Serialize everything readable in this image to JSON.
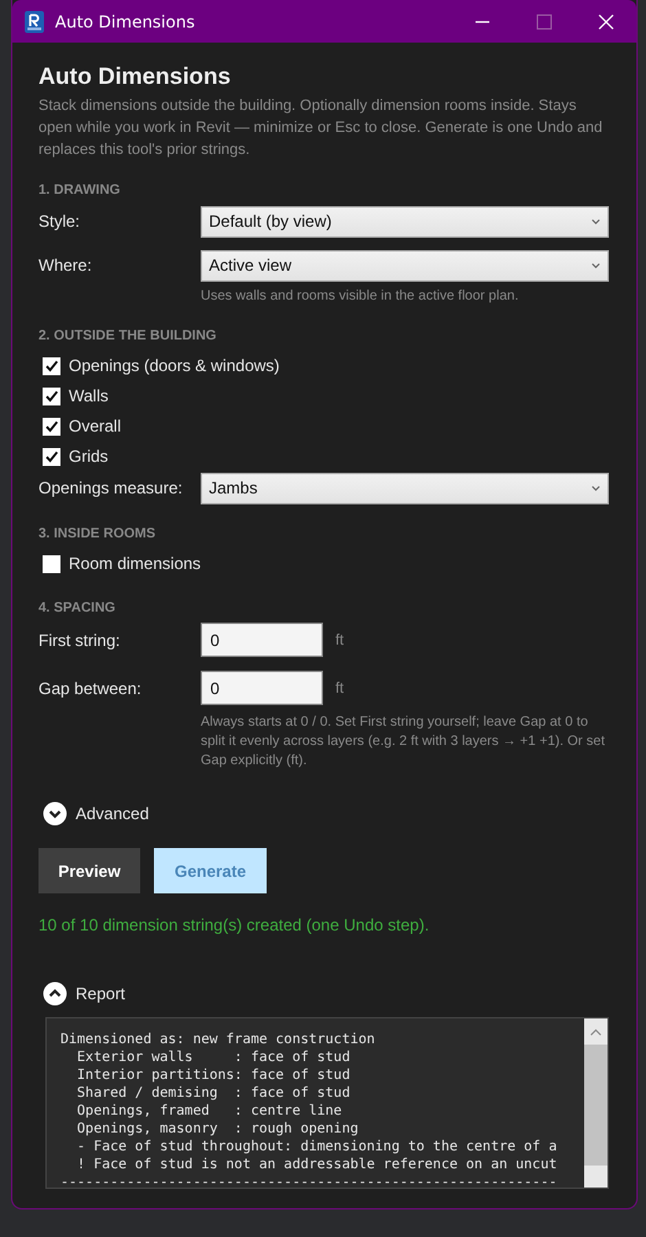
{
  "window": {
    "title": "Auto Dimensions"
  },
  "heading": "Auto Dimensions",
  "description": "Stack dimensions outside the building. Optionally dimension rooms inside. Stays open while you work in Revit — minimize or Esc to close. Generate is one Undo and replaces this tool's prior strings.",
  "sections": [
    {
      "title": "1. DRAWING",
      "items": [
        {
          "kind": "dropdown",
          "label": "Style:",
          "value": "Default (by view)"
        },
        {
          "kind": "dropdown",
          "label": "Where:",
          "value": "Active view"
        },
        {
          "kind": "hint",
          "text": "Uses walls and rooms visible in the active floor plan."
        }
      ]
    },
    {
      "title": "2. OUTSIDE THE BUILDING",
      "items": [
        {
          "kind": "checkbox",
          "label": "Openings (doors & windows)",
          "checked": true
        },
        {
          "kind": "checkbox",
          "label": "Walls",
          "checked": true
        },
        {
          "kind": "checkbox",
          "label": "Overall",
          "checked": true
        },
        {
          "kind": "checkbox",
          "label": "Grids",
          "checked": true
        },
        {
          "kind": "dropdown",
          "label": "Openings measure:",
          "value": "Jambs"
        }
      ]
    },
    {
      "title": "3. INSIDE ROOMS",
      "items": [
        {
          "kind": "checkbox",
          "label": "Room dimensions",
          "checked": false
        }
      ]
    },
    {
      "title": "4. SPACING",
      "items": [
        {
          "kind": "number",
          "label": "First string:",
          "value": "0",
          "unit": "ft"
        },
        {
          "kind": "number",
          "label": "Gap between:",
          "value": "0",
          "unit": "ft"
        },
        {
          "kind": "hint",
          "text": "Always starts at 0 / 0. Set First string yourself; leave Gap at 0 to split it evenly across layers (e.g. 2 ft with 3 layers → +1 +1). Or set Gap explicitly (ft)."
        }
      ]
    }
  ],
  "advanced": {
    "label": "Advanced",
    "expanded": false
  },
  "buttons": [
    {
      "label": "Preview",
      "disabled": false
    },
    {
      "label": "Generate",
      "disabled": true
    }
  ],
  "status": "10 of 10 dimension string(s) created (one Undo step).",
  "report": {
    "label": "Report",
    "expanded": true,
    "lines": [
      "Dimensioned as: new frame construction",
      "  Exterior walls     : face of stud",
      "  Interior partitions: face of stud",
      "  Shared / demising  : face of stud",
      "  Openings, framed   : centre line",
      "  Openings, masonry  : rough opening",
      "  - Face of stud throughout: dimensioning to the centre of a",
      "  ! Face of stud is not an addressable reference on an uncut",
      "------------------------------------------------------------"
    ]
  }
}
